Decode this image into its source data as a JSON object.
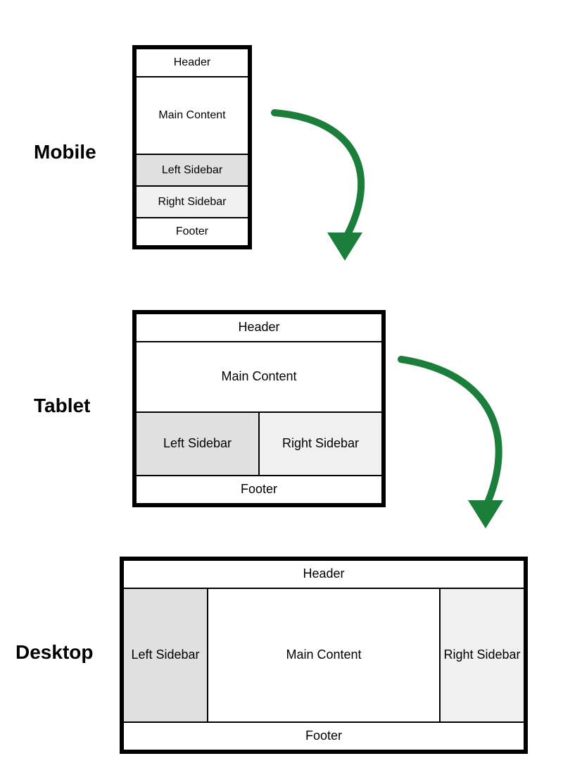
{
  "colors": {
    "arrow": "#1b7f3b",
    "left_sidebar_fill": "#e0e0e0",
    "right_sidebar_fill": "#f0f0f0",
    "border": "#000000"
  },
  "breakpoints": {
    "mobile": {
      "label": "Mobile",
      "regions": {
        "header": "Header",
        "main": "Main Content",
        "left_sidebar": "Left Sidebar",
        "right_sidebar": "Right Sidebar",
        "footer": "Footer"
      }
    },
    "tablet": {
      "label": "Tablet",
      "regions": {
        "header": "Header",
        "main": "Main Content",
        "left_sidebar": "Left Sidebar",
        "right_sidebar": "Right Sidebar",
        "footer": "Footer"
      }
    },
    "desktop": {
      "label": "Desktop",
      "regions": {
        "header": "Header",
        "main": "Main Content",
        "left_sidebar": "Left Sidebar",
        "right_sidebar": "Right Sidebar",
        "footer": "Footer"
      }
    }
  }
}
